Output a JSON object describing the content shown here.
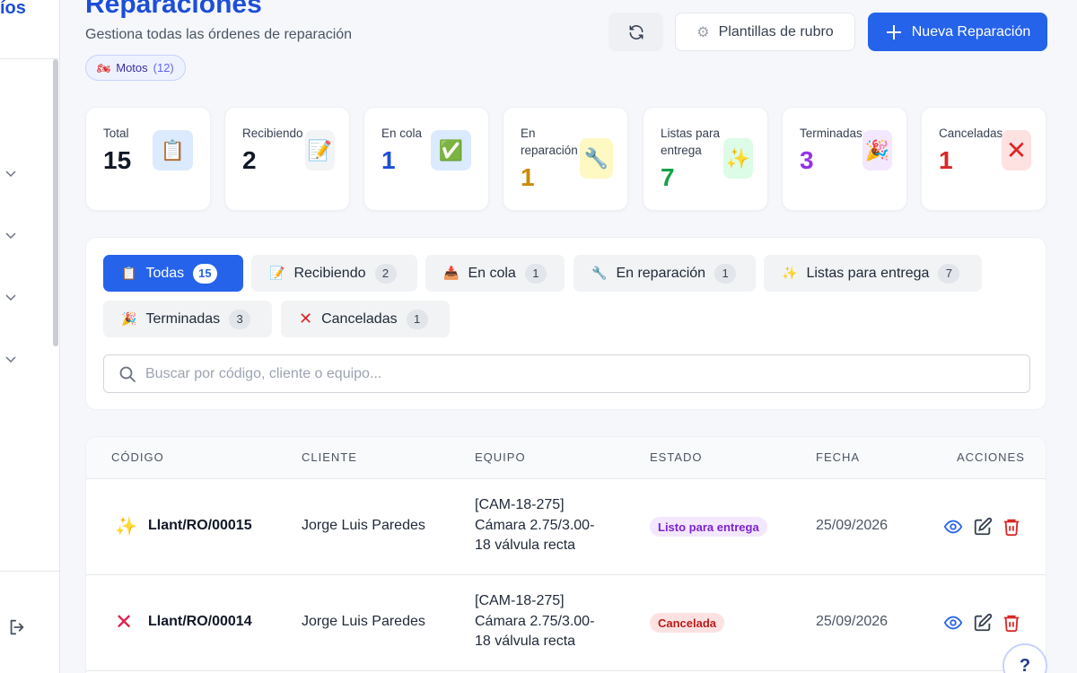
{
  "sidebar": {
    "brand_fragment": "íos"
  },
  "header": {
    "title": "Reparaciones",
    "subtitle": "Gestiona todas las órdenes de reparación",
    "chip": {
      "icon": "motorcycle-icon",
      "label": "Motos",
      "count": "(12)"
    },
    "templates_button": "Plantillas de rubro",
    "new_button": "Nueva Reparación"
  },
  "stats": [
    {
      "label": "Total",
      "value": "15",
      "icon": "clipboard-icon",
      "color": "#111827"
    },
    {
      "label": "Recibiendo",
      "value": "2",
      "icon": "memo-icon",
      "color": "#111827"
    },
    {
      "label": "En cola",
      "value": "1",
      "icon": "check-box-icon",
      "color": "#1d4ed8"
    },
    {
      "label": "En reparación",
      "value": "1",
      "icon": "wrench-icon",
      "color": "#ca8a04"
    },
    {
      "label": "Listas para entrega",
      "value": "7",
      "icon": "sparkles-icon",
      "color": "#16a34a"
    },
    {
      "label": "Terminadas",
      "value": "3",
      "icon": "party-popper-icon",
      "color": "#9333ea"
    },
    {
      "label": "Canceladas",
      "value": "1",
      "icon": "cross-mark-icon",
      "color": "#dc2626"
    }
  ],
  "tabs": [
    {
      "label": "Todas",
      "count": "15",
      "icon": "clipboard-icon"
    },
    {
      "label": "Recibiendo",
      "count": "2",
      "icon": "memo-icon"
    },
    {
      "label": "En cola",
      "count": "1",
      "icon": "inbox-tray-icon"
    },
    {
      "label": "En reparación",
      "count": "1",
      "icon": "wrench-icon"
    },
    {
      "label": "Listas para entrega",
      "count": "7",
      "icon": "sparkles-icon"
    },
    {
      "label": "Terminadas",
      "count": "3",
      "icon": "party-popper-icon"
    },
    {
      "label": "Canceladas",
      "count": "1",
      "icon": "cross-mark-icon"
    }
  ],
  "search": {
    "placeholder": "Buscar por código, cliente o equipo...",
    "value": ""
  },
  "table": {
    "headers": [
      "CÓDIGO",
      "CLIENTE",
      "EQUIPO",
      "ESTADO",
      "FECHA",
      "ACCIONES"
    ],
    "rows": [
      {
        "icon": "sparkles-icon",
        "code": "Llant/RO/00015",
        "client": "Jorge Luis Paredes",
        "equipment_line1": "[CAM-18-275]",
        "equipment_line2": "Cámara 2.75/3.00-",
        "equipment_line3": "18 válvula recta",
        "status": "Listo para entrega",
        "status_color": "#7e22ce",
        "status_bg": "#f3e8ff",
        "date": "25/09/2026"
      },
      {
        "icon": "cross-mark-icon",
        "code": "Llant/RO/00014",
        "client": "Jorge Luis Paredes",
        "equipment_line1": "[CAM-18-275]",
        "equipment_line2": "Cámara 2.75/3.00-",
        "equipment_line3": "18 válvula recta",
        "status": "Cancelada",
        "status_color": "#b91c1c",
        "status_bg": "#fee2e2",
        "date": "25/09/2026"
      }
    ]
  },
  "help_button": "?"
}
